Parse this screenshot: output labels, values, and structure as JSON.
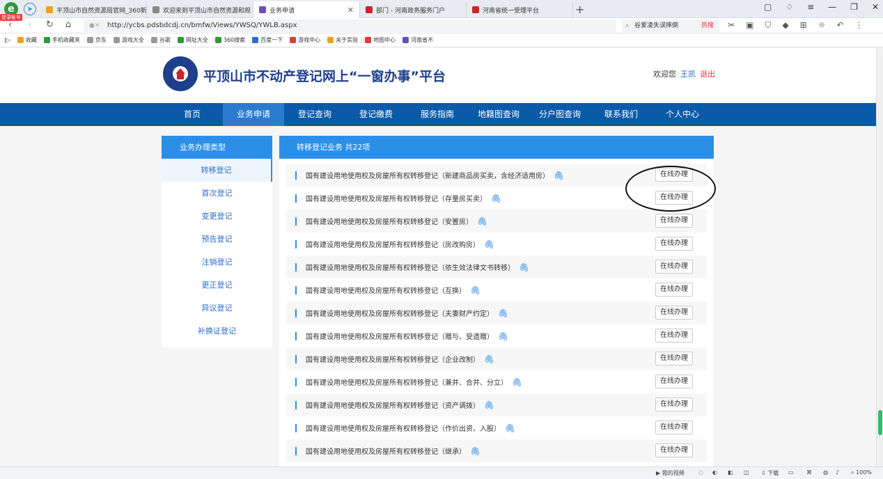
{
  "browser": {
    "tabs": [
      {
        "title": "平顶山市自然资源局官网_360新",
        "icon_color": "#f0a020",
        "active": false
      },
      {
        "title": "欢迎来到平顶山市自然资源和规",
        "icon_color": "#888888",
        "active": false
      },
      {
        "title": "业务申请",
        "icon_color": "#6a4fb8",
        "active": true
      },
      {
        "title": "部门 - 河南政务服务门户",
        "icon_color": "#c8262c",
        "active": false
      },
      {
        "title": "河南省统一受理平台",
        "icon_color": "#c8262c",
        "active": false
      }
    ],
    "login_badge": "登录账号",
    "url": "http://ycbs.pdsbdcdj.cn/bmfw/Views/YWSQ/YWLB.aspx",
    "search_placeholder": "谷爱凌失误摔倒",
    "search_hot": "热搜",
    "bookmarks": [
      {
        "label": "收藏",
        "color": "#f0a020"
      },
      {
        "label": "手机收藏夹",
        "color": "#2e9a3a"
      },
      {
        "label": "京东",
        "color": "#999999"
      },
      {
        "label": "游戏大全",
        "color": "#999999"
      },
      {
        "label": "谷歌",
        "color": "#999999"
      },
      {
        "label": "网址大全",
        "color": "#2e9a3a"
      },
      {
        "label": "360搜索",
        "color": "#2e9a3a"
      },
      {
        "label": "百度一下",
        "color": "#2b6dc6"
      },
      {
        "label": "游戏中心",
        "color": "#e23b3b"
      },
      {
        "label": "关于实验",
        "color": "#f0a020"
      },
      {
        "label": "地图中心",
        "color": "#e23b3b"
      },
      {
        "label": "河南省不",
        "color": "#6a4fb8"
      }
    ],
    "status": {
      "video": "我的视频",
      "download": "下载",
      "zoom": "100%"
    }
  },
  "site": {
    "title": "平顶山市不动产登记网上“一窗办事”平台",
    "welcome": "欢迎您",
    "user": "王凯",
    "logout": "退出"
  },
  "nav": [
    {
      "label": "首页",
      "active": false
    },
    {
      "label": "业务申请",
      "active": true
    },
    {
      "label": "登记查询",
      "active": false
    },
    {
      "label": "登记缴费",
      "active": false
    },
    {
      "label": "服务指南",
      "active": false
    },
    {
      "label": "地籍图查询",
      "active": false
    },
    {
      "label": "分户图查询",
      "active": false
    },
    {
      "label": "联系我们",
      "active": false
    },
    {
      "label": "个人中心",
      "active": false
    }
  ],
  "sidebar": {
    "heading": "业务办理类型",
    "items": [
      {
        "label": "转移登记",
        "active": true
      },
      {
        "label": "首次登记",
        "active": false
      },
      {
        "label": "变更登记",
        "active": false
      },
      {
        "label": "预告登记",
        "active": false
      },
      {
        "label": "注销登记",
        "active": false
      },
      {
        "label": "更正登记",
        "active": false
      },
      {
        "label": "异议登记",
        "active": false
      },
      {
        "label": "补换证登记",
        "active": false
      }
    ]
  },
  "list": {
    "heading": "转移登记业务  共22项",
    "button_label": "在线办理",
    "items": [
      "国有建设用地使用权及房屋所有权转移登记（新建商品房买卖，含经济适用房）",
      "国有建设用地使用权及房屋所有权转移登记（存量房买卖）",
      "国有建设用地使用权及房屋所有权转移登记（安置房）",
      "国有建设用地使用权及房屋所有权转移登记（房改购房）",
      "国有建设用地使用权及房屋所有权转移登记（依生效法律文书转移）",
      "国有建设用地使用权及房屋所有权转移登记（互换）",
      "国有建设用地使用权及房屋所有权转移登记（夫妻财产约定）",
      "国有建设用地使用权及房屋所有权转移登记（赠与、受遗赠）",
      "国有建设用地使用权及房屋所有权转移登记（企业改制）",
      "国有建设用地使用权及房屋所有权转移登记（兼并、合并、分立）",
      "国有建设用地使用权及房屋所有权转移登记（资产调拨）",
      "国有建设用地使用权及房屋所有权转移登记（作价出资、入股）",
      "国有建设用地使用权及房屋所有权转移登记（继承）"
    ]
  }
}
